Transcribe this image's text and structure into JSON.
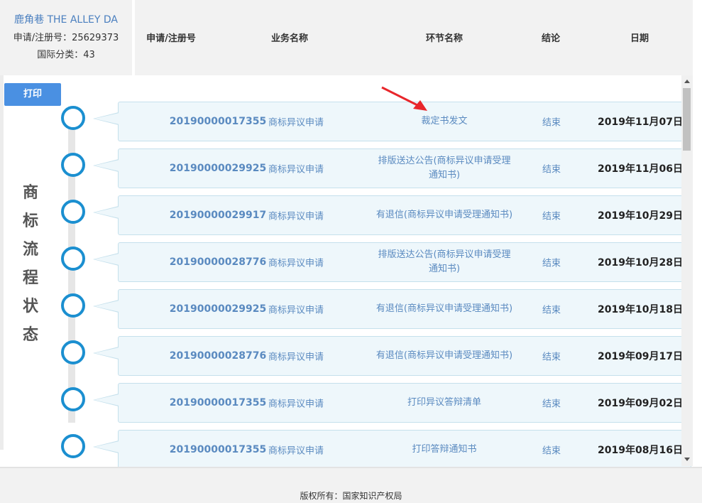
{
  "info": {
    "brand": "鹿角巷 THE ALLEY DA",
    "reg_line": "申请/注册号：25629373",
    "class_line": "国际分类：43"
  },
  "header": {
    "col_reg": "申请/注册号",
    "col_business": "业务名称",
    "col_step": "环节名称",
    "col_result": "结论",
    "col_date": "日期"
  },
  "print_button": "打印",
  "side_title": [
    "商",
    "标",
    "流",
    "程",
    "状",
    "态"
  ],
  "rows": [
    {
      "number": "20190000017355",
      "business": "商标异议申请",
      "step": "裁定书发文",
      "result": "结束",
      "date": "2019年11月07日"
    },
    {
      "number": "20190000029925",
      "business": "商标异议申请",
      "step": "排版送达公告(商标异议申请受理通知书)",
      "result": "结束",
      "date": "2019年11月06日"
    },
    {
      "number": "20190000029917",
      "business": "商标异议申请",
      "step": "有退信(商标异议申请受理通知书)",
      "result": "结束",
      "date": "2019年10月29日"
    },
    {
      "number": "20190000028776",
      "business": "商标异议申请",
      "step": "排版送达公告(商标异议申请受理通知书)",
      "result": "结束",
      "date": "2019年10月28日"
    },
    {
      "number": "20190000029925",
      "business": "商标异议申请",
      "step": "有退信(商标异议申请受理通知书)",
      "result": "结束",
      "date": "2019年10月18日"
    },
    {
      "number": "20190000028776",
      "business": "商标异议申请",
      "step": "有退信(商标异议申请受理通知书)",
      "result": "结束",
      "date": "2019年09月17日"
    },
    {
      "number": "20190000017355",
      "business": "商标异议申请",
      "step": "打印异议答辩清单",
      "result": "结束",
      "date": "2019年09月02日"
    },
    {
      "number": "20190000017355",
      "business": "商标异议申请",
      "step": "打印答辩通知书",
      "result": "结束",
      "date": "2019年08月16日"
    }
  ],
  "footer": "版权所有：国家知识产权局",
  "colors": {
    "accent": "#4a90e2",
    "timeline_dot": "#1b8fd0",
    "link_text": "#5a8ac0",
    "annotation": "#e8262b"
  }
}
